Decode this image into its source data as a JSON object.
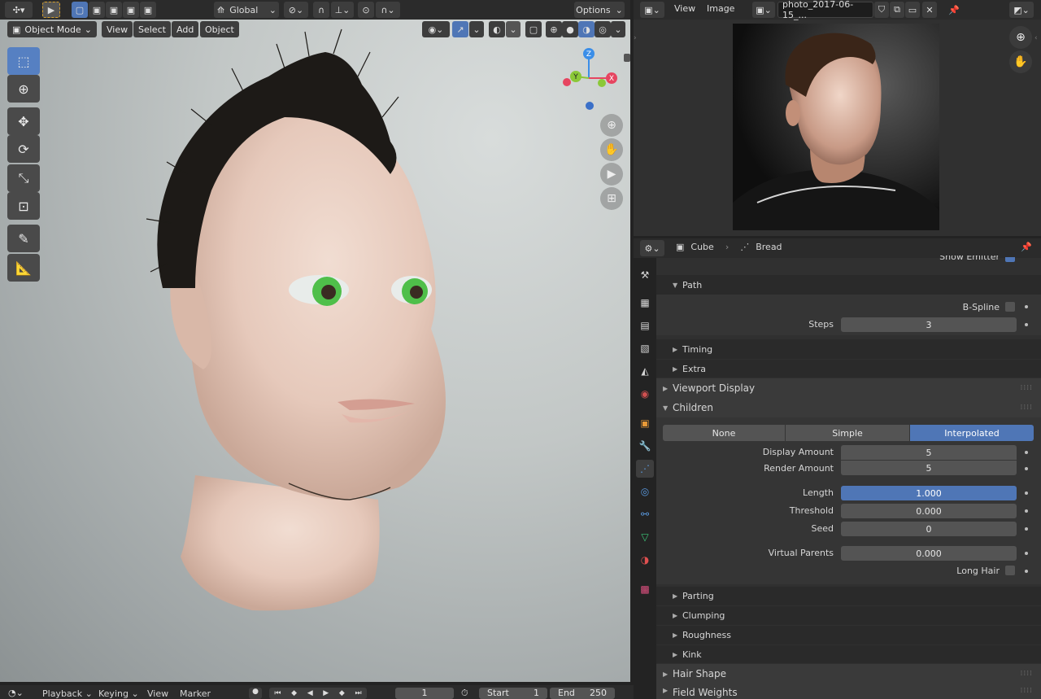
{
  "viewport_header": {
    "transform_orientation": "Global",
    "options_label": "Options",
    "mode": "Object Mode",
    "menus": [
      "View",
      "Select",
      "Add",
      "Object"
    ]
  },
  "image_editor": {
    "menus": [
      "View",
      "Image"
    ],
    "image_name": "photo_2017-06-15_..."
  },
  "properties": {
    "breadcrumb": {
      "object": "Cube",
      "particle": "Bread"
    },
    "clipped_label": "Show Emitter",
    "path_section": "Path",
    "bspline_label": "B-Spline",
    "steps_label": "Steps",
    "steps_value": "3",
    "timing_label": "Timing",
    "extra_label": "Extra",
    "viewport_display_label": "Viewport Display",
    "children_label": "Children",
    "children_modes": [
      "None",
      "Simple",
      "Interpolated"
    ],
    "children_active": "Interpolated",
    "display_amount_label": "Display Amount",
    "display_amount_value": "5",
    "render_amount_label": "Render Amount",
    "render_amount_value": "5",
    "length_label": "Length",
    "length_value": "1.000",
    "threshold_label": "Threshold",
    "threshold_value": "0.000",
    "seed_label": "Seed",
    "seed_value": "0",
    "virtual_parents_label": "Virtual Parents",
    "virtual_parents_value": "0.000",
    "long_hair_label": "Long Hair",
    "sub_sections": [
      "Parting",
      "Clumping",
      "Roughness",
      "Kink"
    ],
    "hair_shape_label": "Hair Shape",
    "field_weights_label": "Field Weights"
  },
  "timeline": {
    "menus": [
      "Playback",
      "Keying",
      "View",
      "Marker"
    ],
    "current_frame": "1",
    "start_label": "Start",
    "start_value": "1",
    "end_label": "End",
    "end_value": "250"
  },
  "gizmo": {
    "z": "Z",
    "y": "Y",
    "x": "X"
  },
  "colors": {
    "accent": "#4f76b6",
    "x_axis": "#e64560",
    "y_axis": "#8bc838",
    "z_axis": "#3b8ee8"
  }
}
